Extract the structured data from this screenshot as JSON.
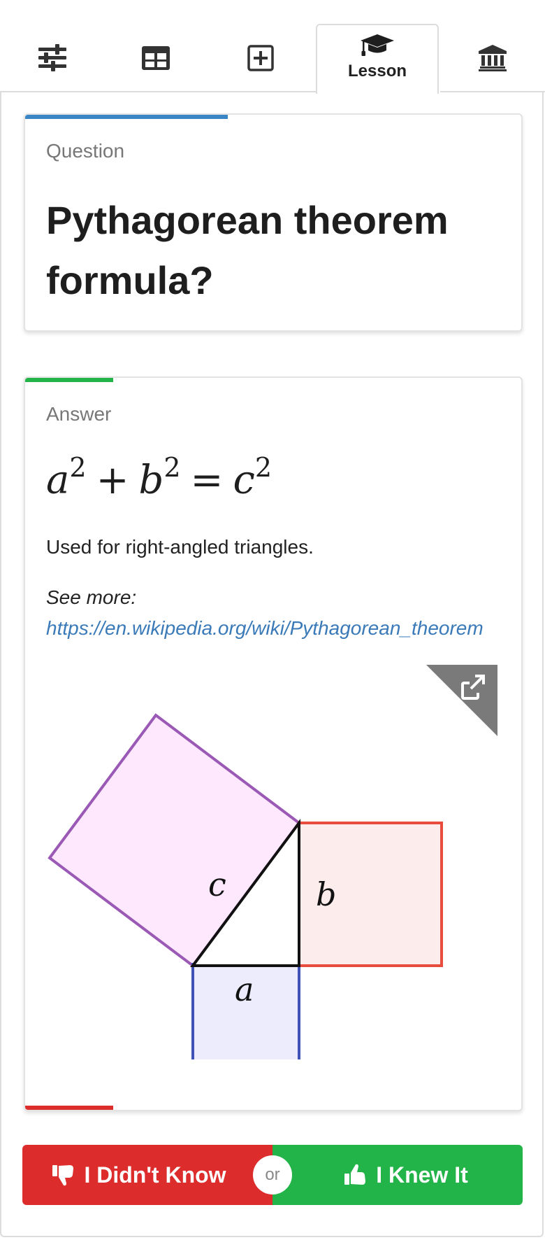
{
  "tabs": {
    "settings_icon": "sliders-icon",
    "table_icon": "table-icon",
    "add_icon": "plus-square-icon",
    "lesson_icon": "graduation-cap-icon",
    "lesson_label": "Lesson",
    "library_icon": "museum-icon",
    "active": "lesson"
  },
  "question_card": {
    "label": "Question",
    "title": "Pythagorean theorem formula?",
    "accent_color": "#3a85c6"
  },
  "answer_card": {
    "label": "Answer",
    "formula": {
      "a": "a",
      "b": "b",
      "c": "c",
      "exp": "2",
      "plus": "+",
      "equals": "="
    },
    "text": "Used for right-angled triangles.",
    "see_more_label": "See more:",
    "see_more_link": "https://en.wikipedia.org/wiki/Pythagorean_theorem",
    "accent_top_color": "#22b448",
    "accent_bottom_color": "#dd2c2c",
    "diagram": {
      "label_a": "a",
      "label_b": "b",
      "label_c": "c",
      "open_icon": "external-link-icon"
    }
  },
  "buttons": {
    "didnt_know": "I Didn't Know",
    "or": "or",
    "knew_it": "I Knew It",
    "didnt_know_icon": "thumbs-down-icon",
    "knew_it_icon": "thumbs-up-icon",
    "red": "#dd2c2c",
    "green": "#22b448"
  }
}
